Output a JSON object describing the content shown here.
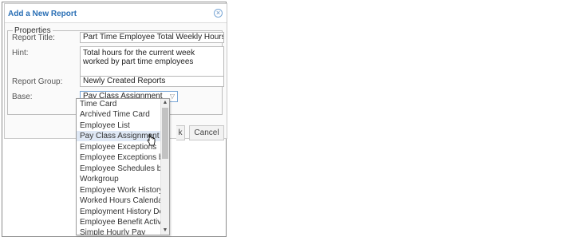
{
  "dialog": {
    "title": "Add a New Report",
    "fieldset_legend": "Properties",
    "fields": {
      "report_title_label": "Report Title:",
      "report_title_value": "Part Time Employee Total Weekly Hours",
      "hint_label": "Hint:",
      "hint_value": "Total hours for the current week worked by part time employees",
      "report_group_label": "Report Group:",
      "report_group_value": "Newly Created Reports",
      "base_label": "Base:",
      "base_value": "Pay Class Assignment"
    },
    "buttons": {
      "ok_partial": "k",
      "cancel": "Cancel"
    }
  },
  "dropdown": {
    "options": [
      "Time Card",
      "Archived Time Card",
      "Employee List",
      "Pay Class Assignment",
      "Employee Exceptions",
      "Employee Exceptions by Day",
      "Employee Schedules by",
      "Workgroup",
      "Employee Work History Grid",
      "Worked Hours Calendar",
      "Employment History Detail",
      "Employee Benefit Activity",
      "Simple Hourly Pay"
    ],
    "selected_index": 3
  },
  "icons": {
    "close": "close-circle-icon",
    "select_chevron": "chevron-down-icon",
    "scroll_up": "scroll-up-arrow-icon",
    "scroll_down": "scroll-down-arrow-icon",
    "cursor": "hand-pointer-icon"
  },
  "colors": {
    "title": "#2a6fb5",
    "selected_option": "#dfe8f5",
    "select_border": "#7aa7d6"
  }
}
